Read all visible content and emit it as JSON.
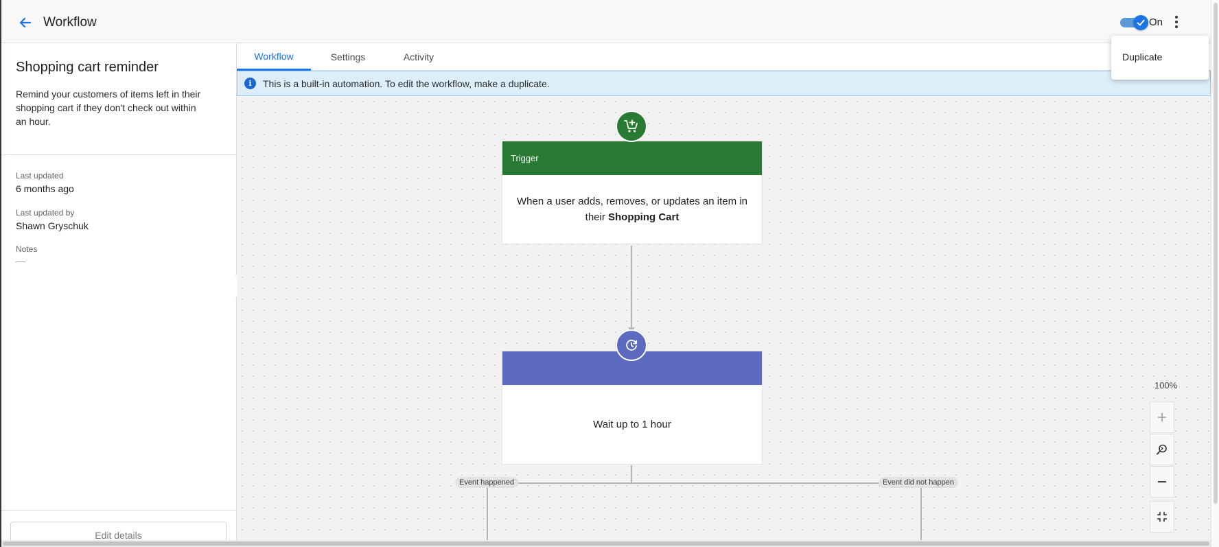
{
  "header": {
    "title": "Workflow",
    "toggle_label": "On",
    "toggle_on": true
  },
  "menu": {
    "items": [
      "Duplicate"
    ]
  },
  "sidebar": {
    "title": "Shopping cart reminder",
    "description": "Remind your customers of items left in their shopping cart if they don't check out within an hour.",
    "last_updated_label": "Last updated",
    "last_updated_value": "6 months ago",
    "last_updated_by_label": "Last updated by",
    "last_updated_by_value": "Shawn Gryschuk",
    "notes_label": "Notes",
    "notes_value": "—",
    "edit_button": "Edit details"
  },
  "tabs": [
    {
      "label": "Workflow",
      "active": true
    },
    {
      "label": "Settings",
      "active": false
    },
    {
      "label": "Activity",
      "active": false
    }
  ],
  "banner": {
    "icon": "info-icon",
    "text": "This is a built-in automation. To edit the workflow, make a duplicate."
  },
  "workflow": {
    "trigger": {
      "icon": "cart-add-icon",
      "color": "#287a32",
      "header": "Trigger",
      "body_prefix": "When a user adds, removes, or updates an item in their",
      "body_bold": "Shopping Cart"
    },
    "wait": {
      "icon": "clock-icon",
      "color": "#5c6bc0",
      "header": "",
      "body": "Wait up to 1 hour"
    },
    "branches": {
      "left": "Event happened",
      "right": "Event did not happen"
    }
  },
  "zoom": {
    "level": "100%"
  },
  "colors": {
    "accent": "#1a73e8",
    "banner_bg": "#ddeefb"
  }
}
